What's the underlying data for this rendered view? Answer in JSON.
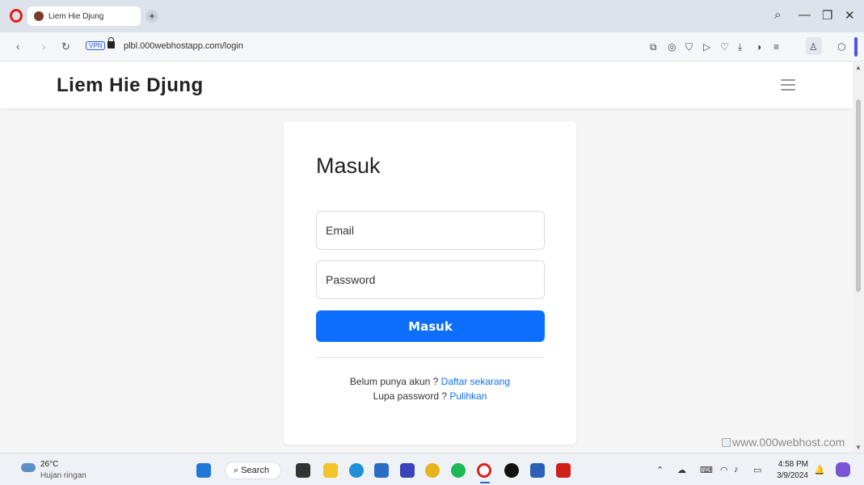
{
  "browser": {
    "tab_title": "Liem Hie Djung",
    "new_tab": "+",
    "vpn_label": "VPN",
    "url": "plbl.000webhostapp.com/login",
    "minimize": "—",
    "restore": "❐",
    "close": "✕",
    "back": "‹",
    "forward": "›",
    "reload": "↻",
    "search": "⌕"
  },
  "site": {
    "brand": "Liem Hie Djung"
  },
  "login": {
    "title": "Masuk",
    "email_placeholder": "Email",
    "password_placeholder": "Password",
    "submit_label": "Masuk",
    "register_prompt": "Belum punya akun ? ",
    "register_link": "Daftar sekarang",
    "recover_prompt": "Lupa password ? ",
    "recover_link": "Pulihkan"
  },
  "watermark": "www.000webhost.com",
  "taskbar": {
    "temperature": "26°C",
    "weather": "Hujan ringan",
    "search_label": "Search",
    "time": "4:58 PM",
    "date": "3/9/2024"
  },
  "colors": {
    "primary": "#0d6efd",
    "opera_red": "#e0201b",
    "accent": "#4d54e8"
  }
}
